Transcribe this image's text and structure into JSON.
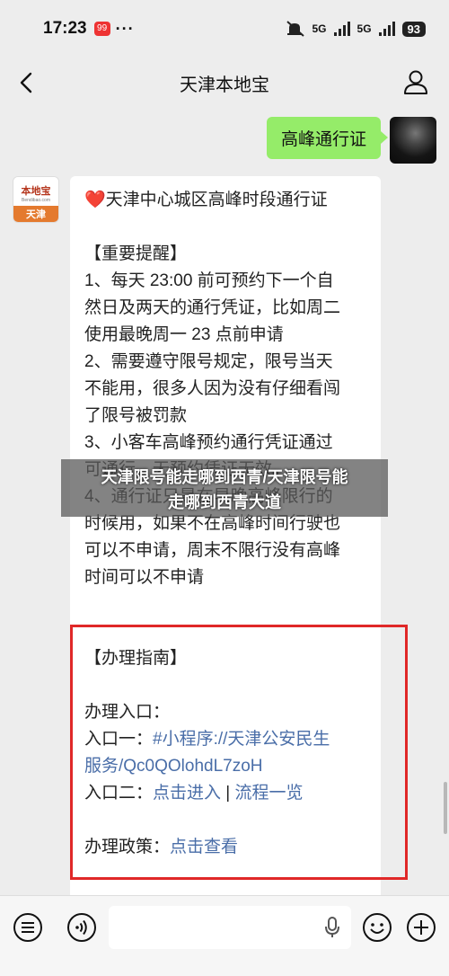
{
  "status": {
    "time": "17:23",
    "badge": "99",
    "dots": "···",
    "net1": "5G",
    "net2": "5G",
    "battery": "93"
  },
  "nav": {
    "title": "天津本地宝"
  },
  "chat": {
    "user_message": "高峰通行证",
    "bot_avatar": {
      "logo": "本地宝",
      "domain": "Bendibao.com",
      "city": "天津"
    },
    "bot_message": {
      "heading": "天津中心城区高峰时段通行证",
      "lines": [
        "【重要提醒】",
        "1、每天 23:00 前可预约下一个自",
        "然日及两天的通行凭证，比如周二",
        "使用最晚周一 23 点前申请",
        "2、需要遵守限号规定，限号当天",
        "不能用，很多人因为没有仔细看闯",
        "了限号被罚款",
        "3、小客车高峰预约通行凭证通过",
        "可通行，无预约凭证无效。",
        "4、通行证只是在早晚高峰限行的",
        "时候用，如果不在高峰时间行驶也",
        "可以不申请，周末不限行没有高峰",
        "时间可以不申请"
      ],
      "guide_title": "【办理指南】",
      "entry_label": "办理入口：",
      "entry1_label": "入口一：",
      "entry1_link_part1": "#小程序://天津公安民生",
      "entry1_link_part2": "服务/Qc0QOlohdL7zoH",
      "entry2_label": "入口二：",
      "entry2_link1": "点击进入",
      "entry2_sep": " | ",
      "entry2_link2": "流程一览",
      "policy_label": "办理政策：",
      "policy_link": "点击查看"
    }
  },
  "overlay": {
    "line1": "天津限号能走哪到西青/天津限号能",
    "line2": "走哪到西青大道"
  }
}
